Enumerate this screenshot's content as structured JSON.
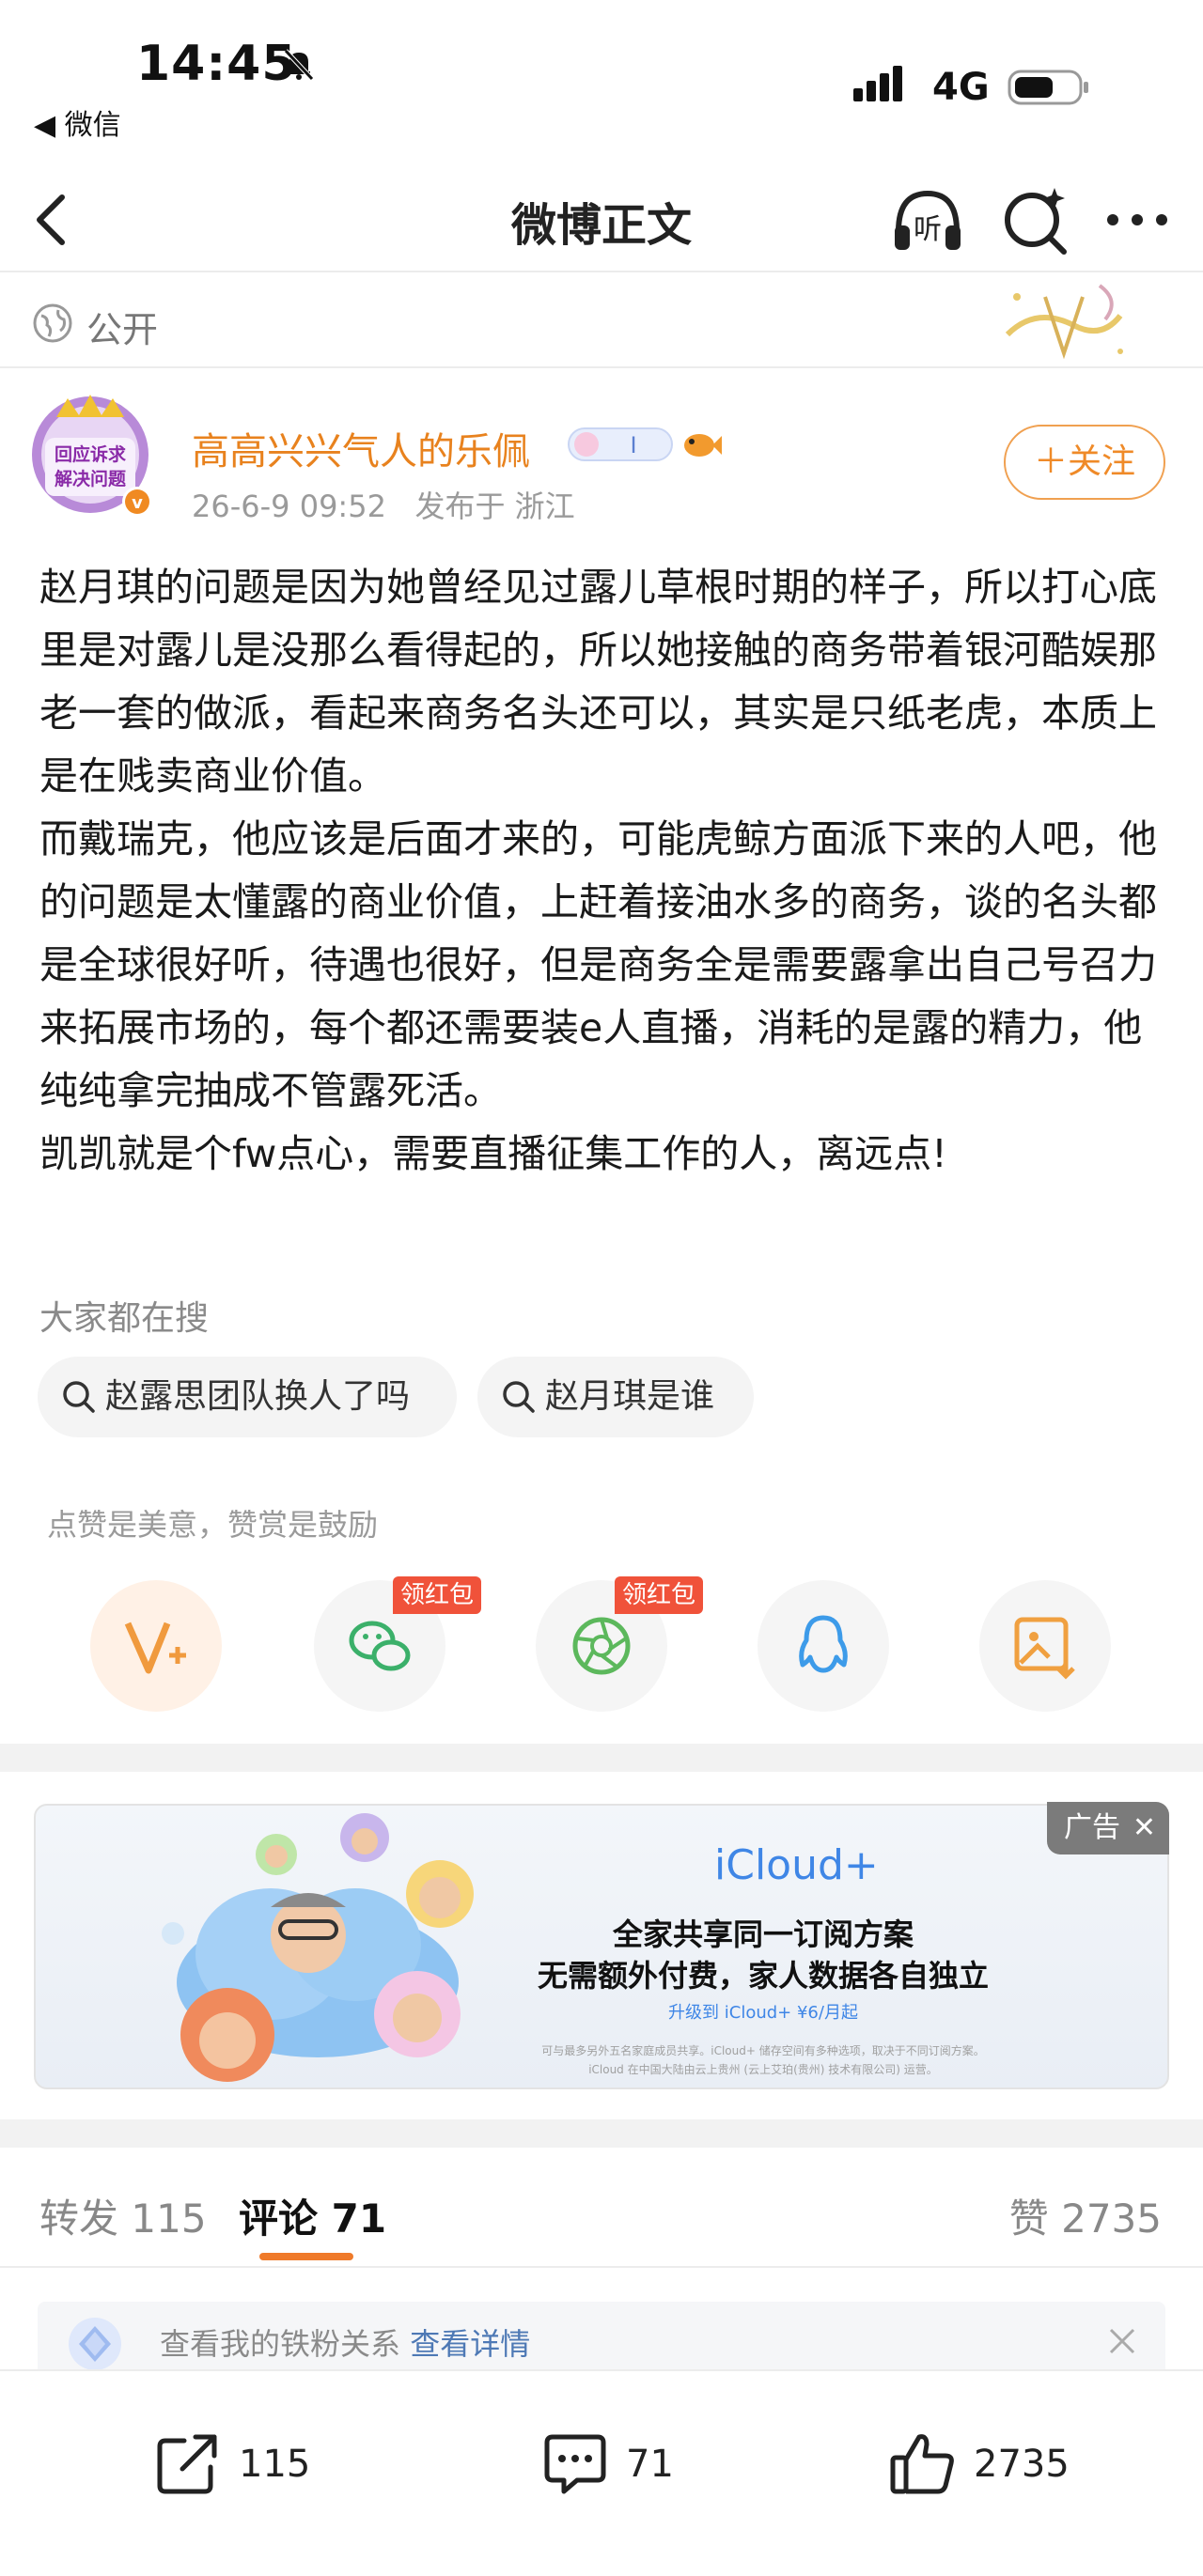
{
  "status_bar": {
    "time": "14:45",
    "back_app": "◀ 微信",
    "network": "4G"
  },
  "nav": {
    "title": "微博正文"
  },
  "visibility": "公开",
  "author": {
    "name": "高高兴兴气人的乐佩",
    "avatar_text_line1": "回应诉求",
    "avatar_text_line2": "解决问题",
    "level_badge": "I",
    "post_time": "26-6-9 09:52",
    "location": "发布于 浙江",
    "follow_label": "＋关注"
  },
  "post": {
    "paragraphs": [
      "赵月琪的问题是因为她曾经见过露儿草根时期的样子，所以打心底里是对露儿是没那么看得起的，所以她接触的商务带着银河酷娱那老一套的做派，看起来商务名头还可以，其实是只纸老虎，本质上是在贱卖商业价值。",
      "而戴瑞克，他应该是后面才来的，可能虎鲸方面派下来的人吧，他的问题是太懂露的商业价值，上赶着接油水多的商务，谈的名头都是全球很好听，待遇也很好，但是商务全是需要露拿出自己号召力来拓展市场的，每个都还需要装e人直播，消耗的是露的精力，他纯纯拿完抽成不管露死活。",
      "凯凯就是个fw点心，需要直播征集工作的人，离远点!"
    ]
  },
  "search": {
    "title": "大家都在搜",
    "chips": [
      "赵露思团队换人了吗",
      "赵月琪是谁"
    ]
  },
  "reward": {
    "tip": "点赞是美意，赞赏是鼓励",
    "hongbao_label": "领红包"
  },
  "ad": {
    "brand": "iCloud+",
    "line1": "全家共享同一订阅方案",
    "line2": "无需额外付费，家人数据各自独立",
    "price": "升级到 iCloud+ ¥6/月起",
    "fine1": "可与最多另外五名家庭成员共享。iCloud+ 储存空间有多种选项，取决于不同订阅方案。",
    "fine2": "iCloud 在中国大陆由云上贵州 (云上艾珀(贵州) 技术有限公司) 运营。",
    "tag": "广告"
  },
  "tabs": {
    "repost_label": "转发",
    "repost_count": "115",
    "comment_label": "评论",
    "comment_count": "71",
    "like_label": "赞",
    "like_count": "2735"
  },
  "fans_bar": {
    "text": "查看我的铁粉关系",
    "link": "查看详情"
  },
  "bottom_bar": {
    "repost_count": "115",
    "comment_count": "71",
    "like_count": "2735"
  },
  "colors": {
    "accent": "#ef8a28",
    "author_name": "#e8821e",
    "hongbao": "#f0523a",
    "link": "#4e79b5",
    "ad_brand": "#3f86e6"
  }
}
